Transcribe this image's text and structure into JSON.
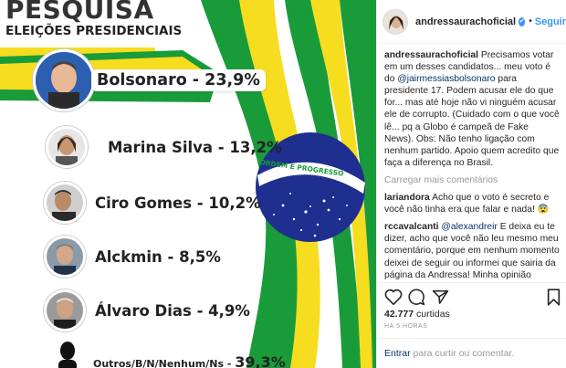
{
  "graphic": {
    "title": "PESQUISA",
    "subtitle": "ELEIÇÕES PRESIDENCIAIS",
    "flag_motto": "ORDEM E PROGRESSO",
    "candidates": [
      {
        "label": "Bolsonaro - 23,9%"
      },
      {
        "label": "Marina Silva - 13,2%"
      },
      {
        "label": "Ciro Gomes - 10,2%"
      },
      {
        "label": "Alckmin - 8,5%"
      },
      {
        "label": "Álvaro Dias - 4,9%"
      },
      {
        "label": "Outros/B/N/Nenhum/Ns - 39,3%"
      }
    ],
    "colors": {
      "green": "#1a9b3a",
      "yellow": "#f6dd1f",
      "blue": "#1f2f8f"
    }
  },
  "header": {
    "username": "andressaurachoficial",
    "verified_icon": "✔",
    "separator": "•",
    "follow_label": "Seguir"
  },
  "caption": {
    "username": "andressaurachoficial",
    "text_before": " Precisamos votar em um desses candidatos... meu voto é do ",
    "mention": "@jairmessiasbolsonaro",
    "text_after": " para presidente 17. Podem acusar ele do que for... mas até hoje não vi ninguém acusar ele de corrupto. (Cuidado com o que você lê... pq a Globo é campeã de Fake News). Obs: Não tenho ligação com nenhum partido. Apoio quem acredito que faça a diferença no Brasil."
  },
  "load_more_label": "Carregar mais comentários",
  "comments": [
    {
      "username": "lariandora",
      "text": " Acho que o voto é secreto e você não tinha era que falar e nada! 😨"
    },
    {
      "username": "rccavalcanti",
      "mention": "@alexandreir",
      "text": " E deixa eu te dizer, acho que você não leu mesmo meu comentário, porque em nenhum momento deixei de seguir ou informei que sairia da página da Andressa! Minha opinião política, sabe separar as coisas! Faz parte do ser humano pensar diferente né, nada a ver."
    }
  ],
  "likes": {
    "count": "42.777",
    "label": " curtidas"
  },
  "timestamp": "HÁ 5 HORAS",
  "comment_box": {
    "link": "Entrar",
    "text": " para curtir ou comentar."
  }
}
